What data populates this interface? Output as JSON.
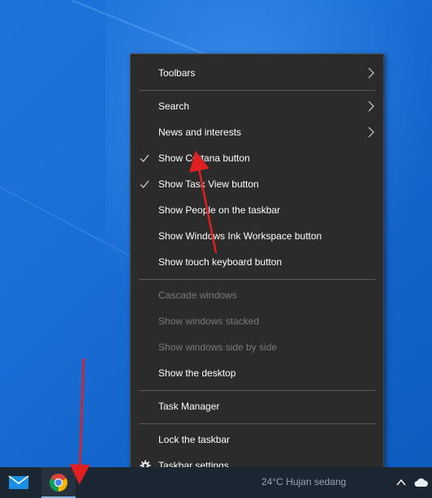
{
  "context_menu": {
    "items": [
      {
        "label": "Toolbars",
        "submenu": true,
        "checked": false,
        "disabled": false
      },
      {
        "label": "Search",
        "submenu": true,
        "checked": false,
        "disabled": false
      },
      {
        "label": "News and interests",
        "submenu": true,
        "checked": false,
        "disabled": false
      },
      {
        "label": "Show Cortana button",
        "submenu": false,
        "checked": true,
        "disabled": false
      },
      {
        "label": "Show Task View button",
        "submenu": false,
        "checked": true,
        "disabled": false
      },
      {
        "label": "Show People on the taskbar",
        "submenu": false,
        "checked": false,
        "disabled": false
      },
      {
        "label": "Show Windows Ink Workspace button",
        "submenu": false,
        "checked": false,
        "disabled": false
      },
      {
        "label": "Show touch keyboard button",
        "submenu": false,
        "checked": false,
        "disabled": false
      },
      {
        "label": "Cascade windows",
        "submenu": false,
        "checked": false,
        "disabled": true
      },
      {
        "label": "Show windows stacked",
        "submenu": false,
        "checked": false,
        "disabled": true
      },
      {
        "label": "Show windows side by side",
        "submenu": false,
        "checked": false,
        "disabled": true
      },
      {
        "label": "Show the desktop",
        "submenu": false,
        "checked": false,
        "disabled": false
      },
      {
        "label": "Task Manager",
        "submenu": false,
        "checked": false,
        "disabled": false
      },
      {
        "label": "Lock the taskbar",
        "submenu": false,
        "checked": false,
        "disabled": false
      },
      {
        "label": "Taskbar settings",
        "submenu": false,
        "checked": false,
        "disabled": false,
        "icon": "gear-icon"
      }
    ]
  },
  "taskbar": {
    "pinned": [
      {
        "name": "mail-icon",
        "active": false
      },
      {
        "name": "chrome-icon",
        "active": true
      }
    ],
    "weather_text": "24°C  Hujan sedang",
    "tray": [
      "show-hidden-icons-chevron",
      "onedrive-cloud-icon"
    ]
  },
  "colors": {
    "menu_bg": "#2b2b2b",
    "menu_text": "#ffffff",
    "menu_disabled_text": "#7a7a7a",
    "separator": "#5a5a5a",
    "taskbar_bg": "#1b2633",
    "desktop_blue": "#1a6fd6",
    "annotation_red": "#e02020"
  }
}
